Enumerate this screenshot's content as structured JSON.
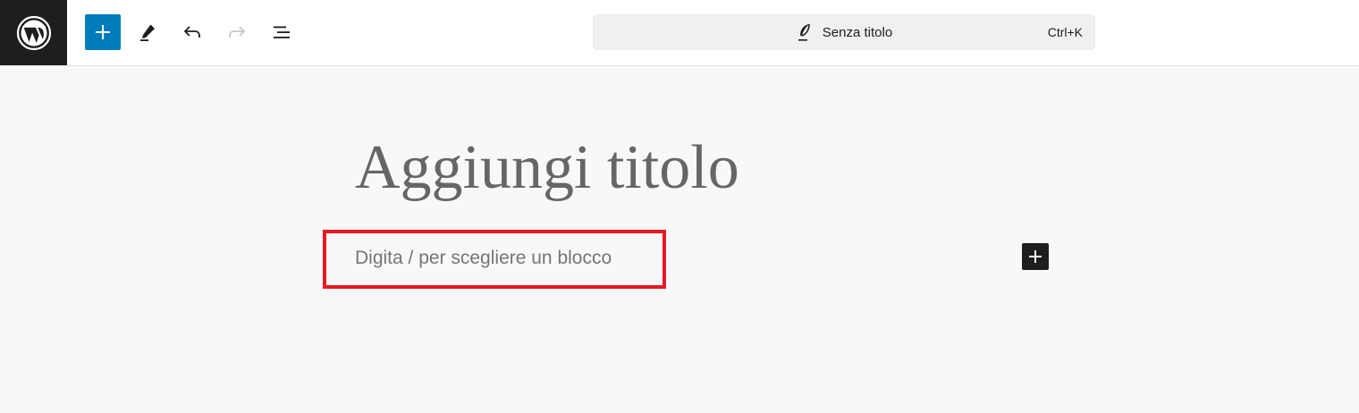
{
  "toolbar": {
    "logo_icon": "wordpress-logo-icon",
    "inserter_icon": "plus-icon",
    "tools_icon": "pencil-icon",
    "undo_icon": "undo-icon",
    "redo_icon": "redo-icon",
    "list_view_icon": "list-view-icon",
    "accent_color": "#007cba"
  },
  "command_bar": {
    "icon": "feather-icon",
    "title": "Senza titolo",
    "shortcut": "Ctrl+K"
  },
  "editor": {
    "title_placeholder": "Aggiungi titolo",
    "block_placeholder": "Digita / per scegliere un blocco",
    "block_inserter_icon": "plus-icon",
    "highlight_color": "#e81823"
  }
}
